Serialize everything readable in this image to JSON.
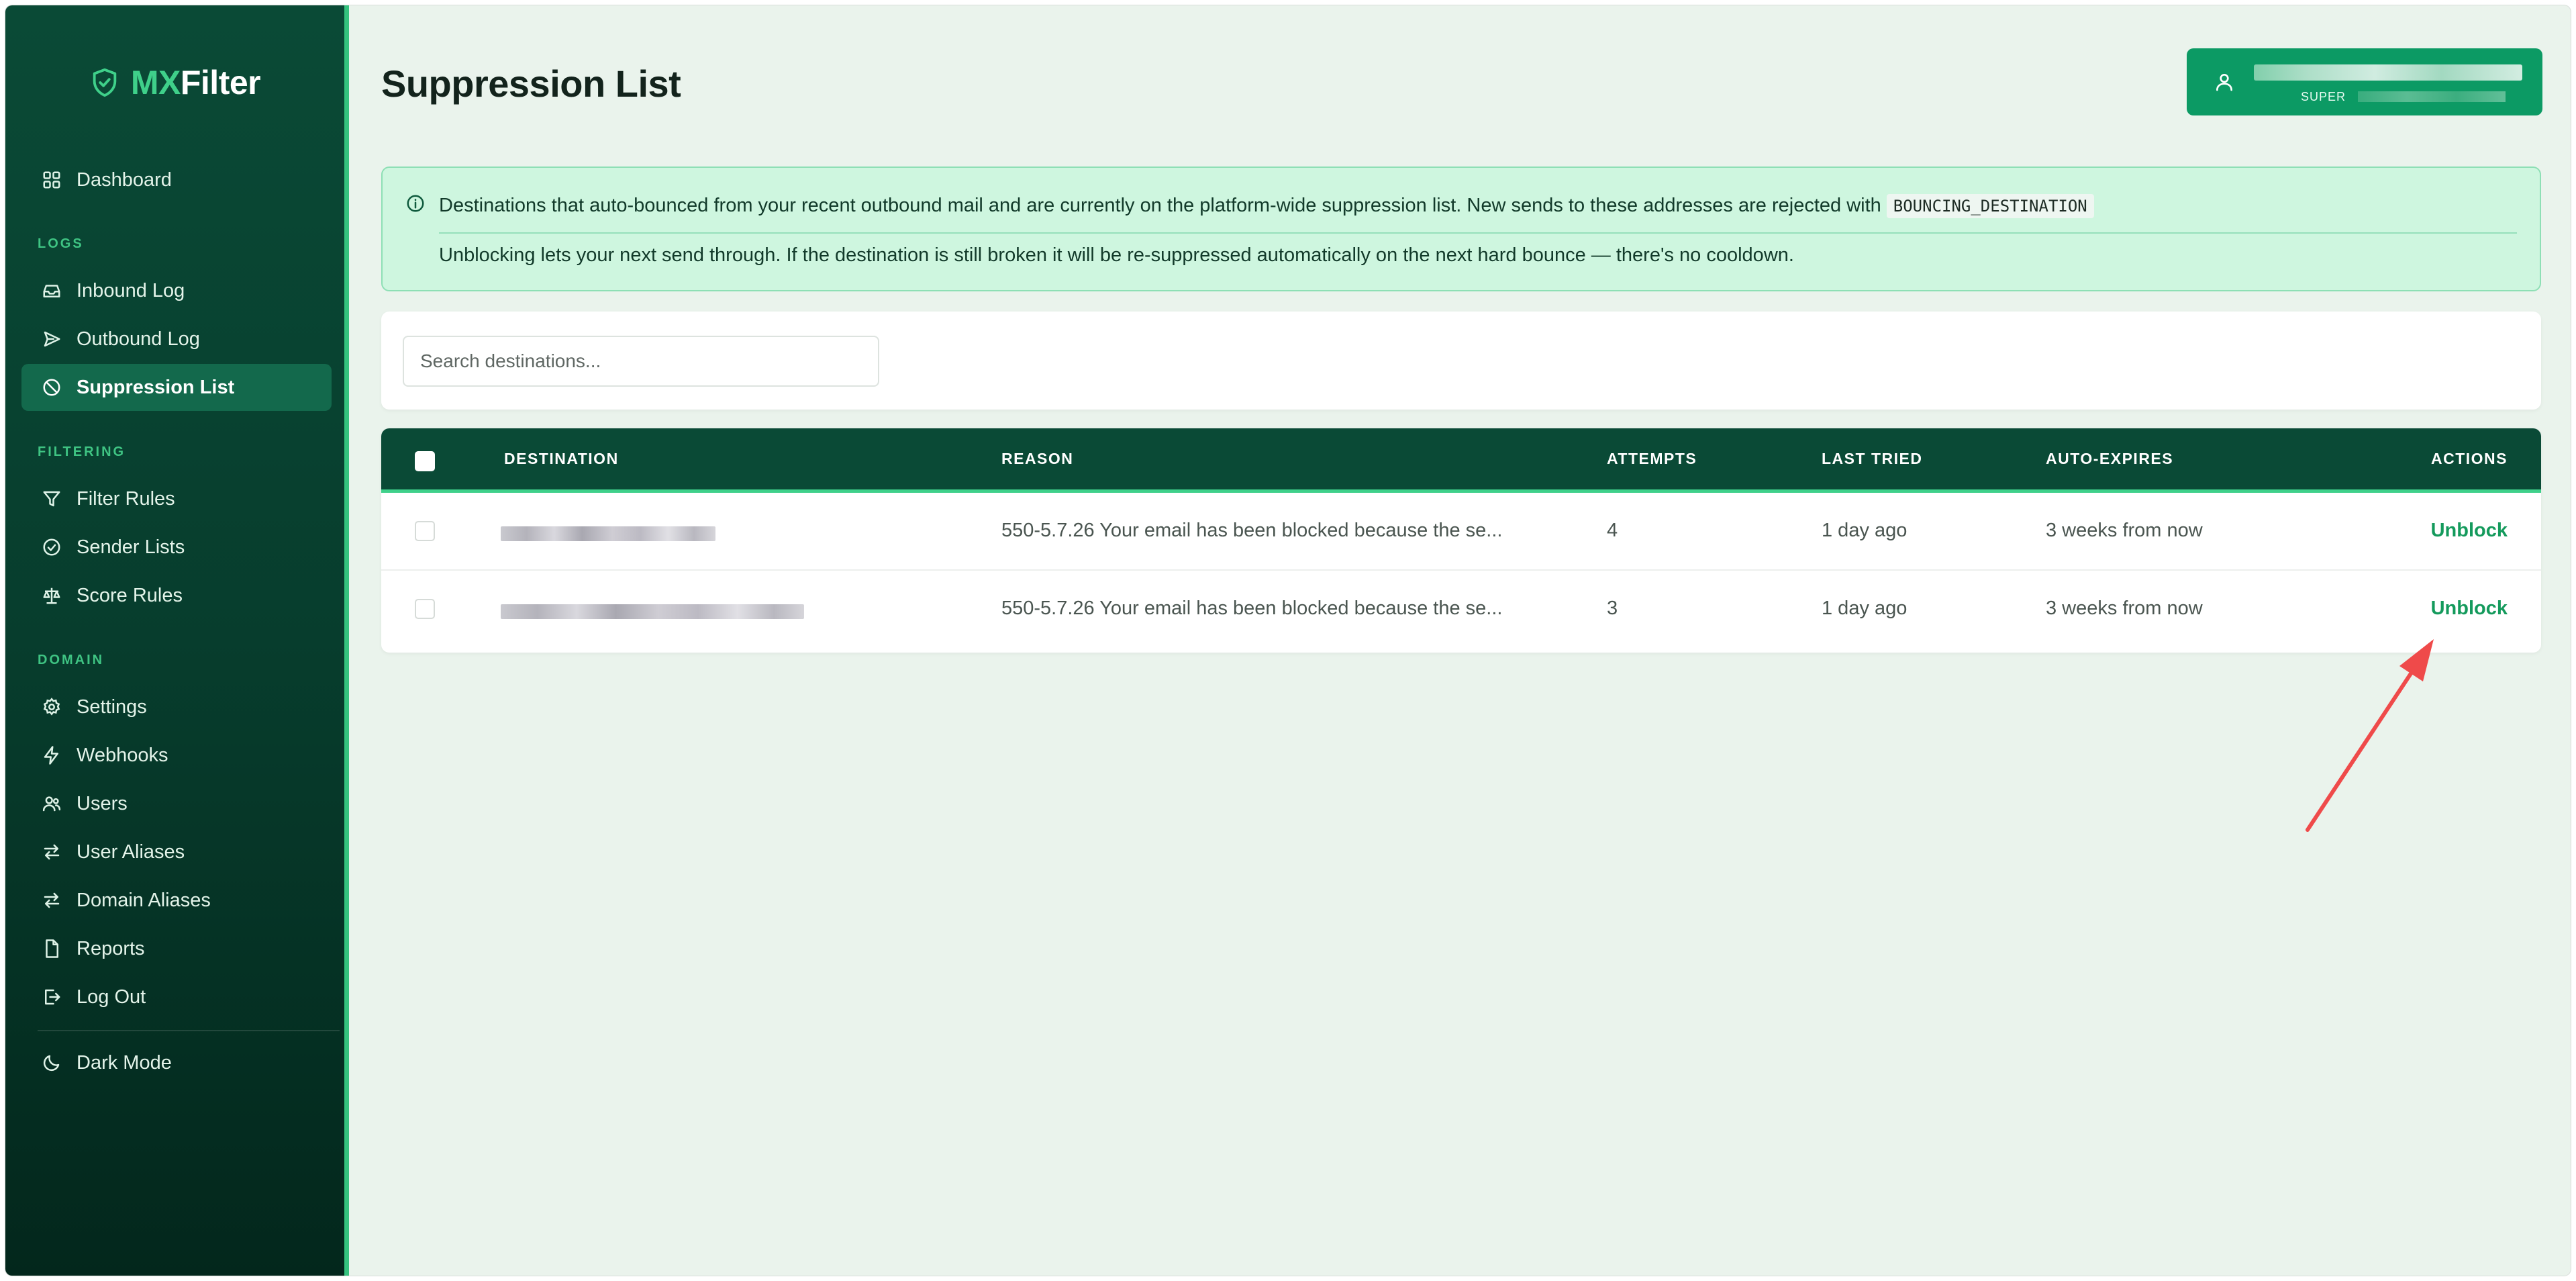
{
  "app": {
    "logo_mx": "MX",
    "logo_filter": "Filter"
  },
  "sidebar": {
    "dashboard": "Dashboard",
    "sections": {
      "logs": "LOGS",
      "filtering": "FILTERING",
      "domain": "DOMAIN"
    },
    "logs": [
      "Inbound Log",
      "Outbound Log",
      "Suppression List"
    ],
    "filtering": [
      "Filter Rules",
      "Sender Lists",
      "Score Rules"
    ],
    "domain": [
      "Settings",
      "Webhooks",
      "Users",
      "User Aliases",
      "Domain Aliases",
      "Reports",
      "Log Out"
    ],
    "dark_mode": "Dark Mode",
    "active": "Suppression List"
  },
  "header": {
    "title": "Suppression List",
    "user_role": "SUPER"
  },
  "info": {
    "line1": "Destinations that auto-bounced from your recent outbound mail and are currently on the platform-wide suppression list. New sends to these addresses are rejected with",
    "code": "BOUNCING_DESTINATION",
    "line2": "Unblocking lets your next send through. If the destination is still broken it will be re-suppressed automatically on the next hard bounce — there's no cooldown."
  },
  "search": {
    "placeholder": "Search destinations..."
  },
  "table": {
    "headers": [
      "DESTINATION",
      "REASON",
      "ATTEMPTS",
      "LAST TRIED",
      "AUTO-EXPIRES",
      "ACTIONS"
    ],
    "rows": [
      {
        "reason": "550-5.7.26 Your email has been blocked because the se...",
        "attempts": "4",
        "last_tried": "1 day ago",
        "auto_expires": "3 weeks from now",
        "action": "Unblock"
      },
      {
        "reason": "550-5.7.26 Your email has been blocked because the se...",
        "attempts": "3",
        "last_tried": "1 day ago",
        "auto_expires": "3 weeks from now",
        "action": "Unblock"
      }
    ]
  },
  "colors": {
    "sidebar_bg": "#0a4a36",
    "accent": "#3fd08a",
    "action_link": "#149a5c",
    "annotation_arrow": "#ef4a4a"
  }
}
